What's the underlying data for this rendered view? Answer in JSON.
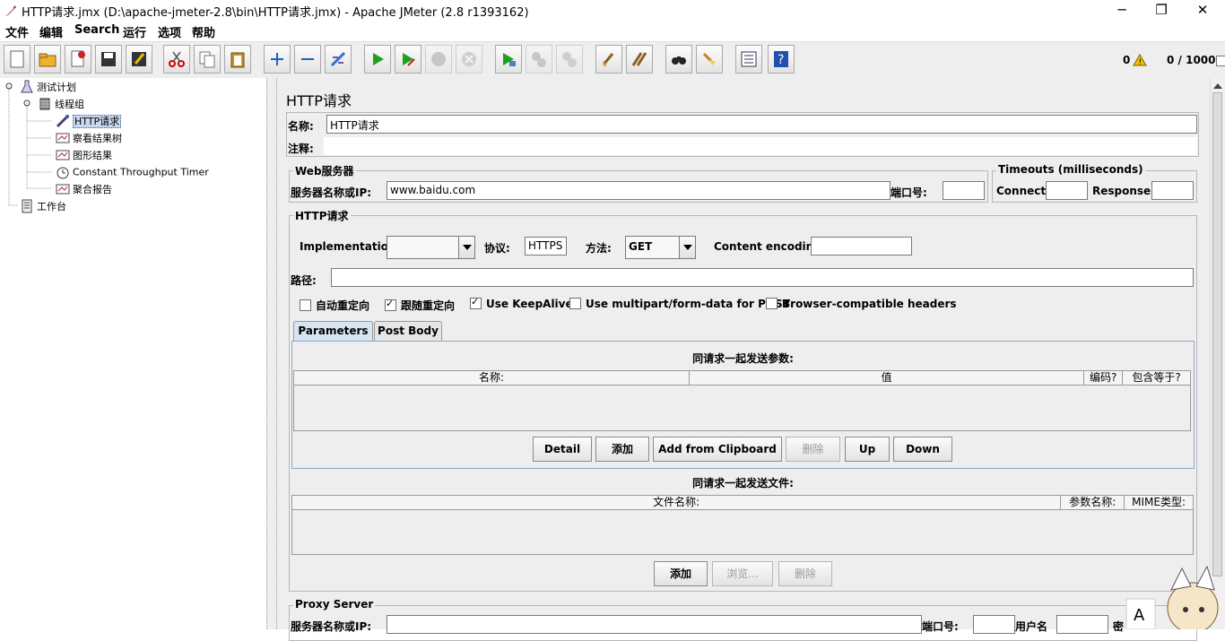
{
  "window": {
    "title": "HTTP请求.jmx (D:\\apache-jmeter-2.8\\bin\\HTTP请求.jmx) - Apache JMeter (2.8 r1393162)",
    "minimize": "─",
    "maximize": "❐",
    "close": "✕"
  },
  "menu": [
    "文件",
    "编辑",
    "Search",
    "运行",
    "选项",
    "帮助"
  ],
  "status": {
    "error_count": "0",
    "threads": "0 / 1000"
  },
  "tree": {
    "items": [
      {
        "label": "测试计划"
      },
      {
        "label": "线程组"
      },
      {
        "label": "HTTP请求"
      },
      {
        "label": "察看结果树"
      },
      {
        "label": "图形结果"
      },
      {
        "label": "Constant Throughput Timer"
      },
      {
        "label": "聚合报告"
      },
      {
        "label": "工作台"
      }
    ]
  },
  "panel": {
    "title": "HTTP请求",
    "name_label": "名称:",
    "name_value": "HTTP请求",
    "comment_label": "注释:",
    "web_server": {
      "group_title": "Web服务器",
      "server_label": "服务器名称或IP:",
      "server_value": "www.baidu.com",
      "port_label": "端口号:",
      "port_value": ""
    },
    "timeouts": {
      "group_title": "Timeouts (milliseconds)",
      "connect_label": "Connect:",
      "response_label": "Response:"
    },
    "http_request": {
      "group_title": "HTTP请求",
      "impl_label": "Implementation:",
      "impl_value": "",
      "protocol_label": "协议:",
      "protocol_value": "HTTPS",
      "method_label": "方法:",
      "method_value": "GET",
      "encoding_label": "Content encoding:",
      "encoding_value": "",
      "path_label": "路径:",
      "path_value": ""
    },
    "checkboxes": [
      {
        "label": "自动重定向",
        "checked": false
      },
      {
        "label": "跟随重定向",
        "checked": true
      },
      {
        "label": "Use KeepAlive",
        "checked": true
      },
      {
        "label": "Use multipart/form-data for POST",
        "checked": false
      },
      {
        "label": "Browser-compatible headers",
        "checked": false
      }
    ],
    "tabs": [
      "Parameters",
      "Post Body"
    ],
    "params": {
      "title": "同请求一起发送参数:",
      "columns": [
        "名称:",
        "值",
        "编码?",
        "包含等于?"
      ],
      "buttons": [
        "Detail",
        "添加",
        "Add from Clipboard",
        "删除",
        "Up",
        "Down"
      ]
    },
    "files": {
      "title": "同请求一起发送文件:",
      "columns": [
        "文件名称:",
        "参数名称:",
        "MIME类型:"
      ],
      "buttons": [
        "添加",
        "浏览...",
        "删除"
      ]
    },
    "proxy": {
      "group_title": "Proxy Server",
      "server_label": "服务器名称或IP:",
      "port_label": "端口号:",
      "user_label": "用户名",
      "pass_label": "密"
    }
  },
  "colors": {
    "accent": "#d7e4f2",
    "selection": "#c8d8ee",
    "panel_bg": "#eeeeee"
  }
}
